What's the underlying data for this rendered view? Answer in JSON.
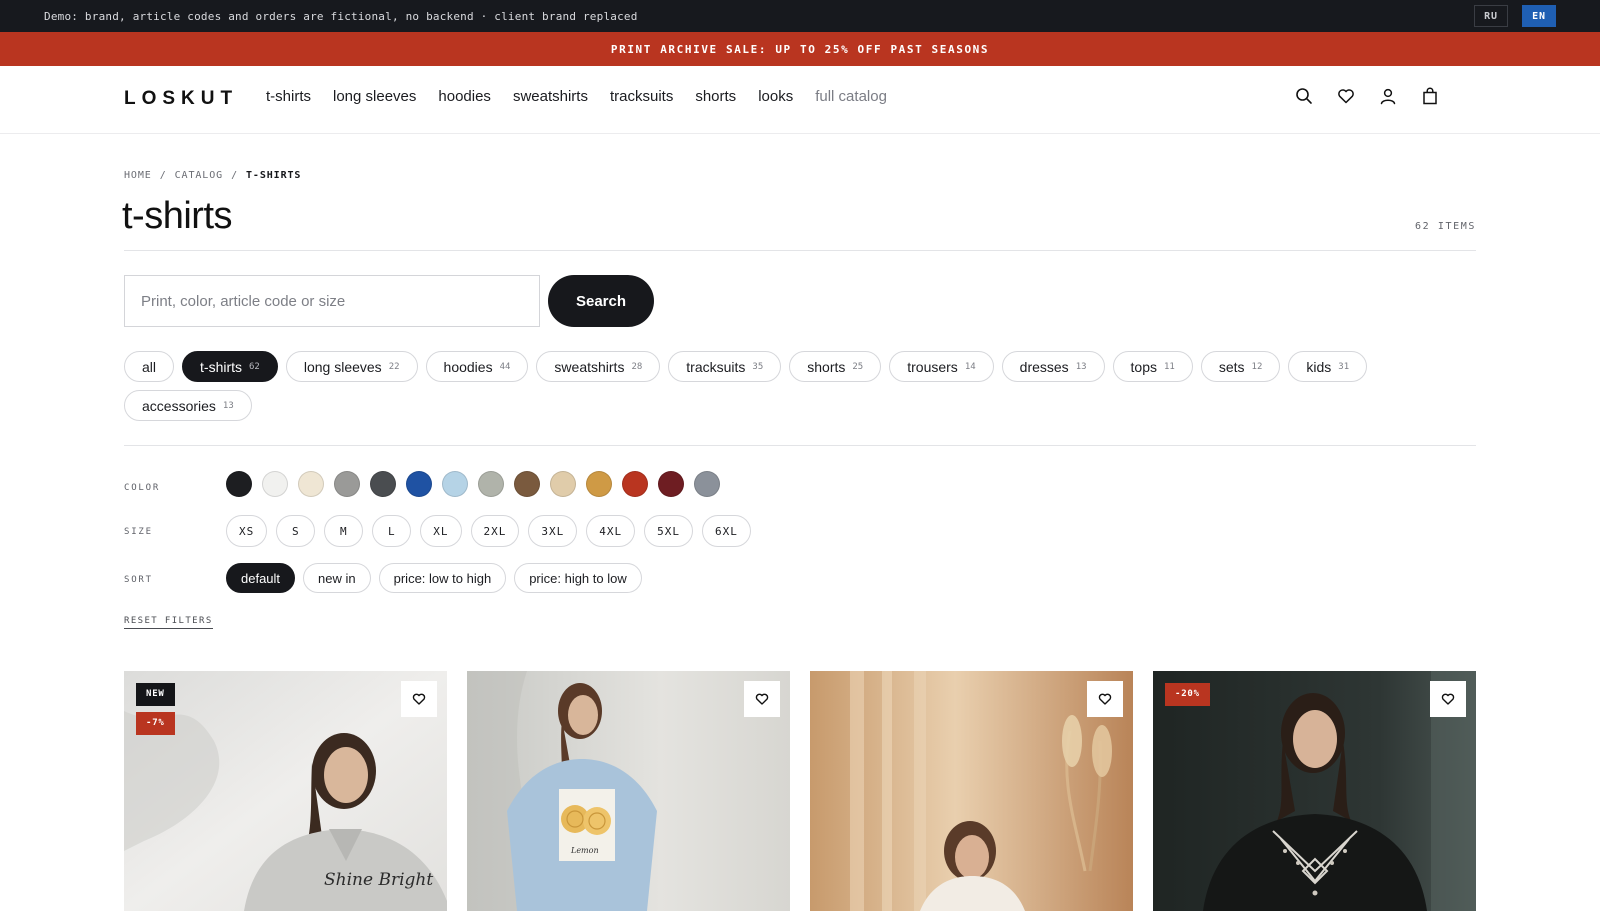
{
  "demo": {
    "text": "Demo: brand, article codes and orders are fictional, no backend · client brand replaced",
    "languages": [
      {
        "label": "RU",
        "active": false
      },
      {
        "label": "EN",
        "active": true
      }
    ]
  },
  "promo": {
    "text": "PRINT ARCHIVE SALE: UP TO 25% OFF PAST SEASONS"
  },
  "header": {
    "logo": "LOSKUT",
    "nav": [
      {
        "label": "t-shirts"
      },
      {
        "label": "long sleeves"
      },
      {
        "label": "hoodies"
      },
      {
        "label": "sweatshirts"
      },
      {
        "label": "tracksuits"
      },
      {
        "label": "shorts"
      },
      {
        "label": "looks"
      },
      {
        "label": "full catalog"
      }
    ],
    "icons": [
      "search-icon",
      "heart-icon",
      "user-icon",
      "bag-icon"
    ]
  },
  "breadcrumb": {
    "home": "HOME",
    "sep": "/",
    "catalog": "CATALOG",
    "current": "T-SHIRTS"
  },
  "page": {
    "title": "t-shirts",
    "count": "62 ITEMS"
  },
  "search": {
    "placeholder": "Print, color, article code or size",
    "button": "Search"
  },
  "categories": [
    {
      "label": "all",
      "count": ""
    },
    {
      "label": "t-shirts",
      "count": "62",
      "active": true
    },
    {
      "label": "long sleeves",
      "count": "22"
    },
    {
      "label": "hoodies",
      "count": "44"
    },
    {
      "label": "sweatshirts",
      "count": "28"
    },
    {
      "label": "tracksuits",
      "count": "35"
    },
    {
      "label": "shorts",
      "count": "25"
    },
    {
      "label": "trousers",
      "count": "14"
    },
    {
      "label": "dresses",
      "count": "13"
    },
    {
      "label": "tops",
      "count": "11"
    },
    {
      "label": "sets",
      "count": "12"
    },
    {
      "label": "kids",
      "count": "31"
    },
    {
      "label": "accessories",
      "count": "13"
    }
  ],
  "filters": {
    "color_label": "COLOR",
    "colors": [
      "#1d1e21",
      "#f1f1ef",
      "#efe6d4",
      "#9a9a98",
      "#4a4d50",
      "#1f52a3",
      "#b5d3e6",
      "#b0b3aa",
      "#7a5a3e",
      "#e0ccaa",
      "#cf9a45",
      "#b93520",
      "#6e1d22",
      "#8b919a"
    ],
    "size_label": "SIZE",
    "sizes": [
      "XS",
      "S",
      "M",
      "L",
      "XL",
      "2XL",
      "3XL",
      "4XL",
      "5XL",
      "6XL"
    ],
    "sort_label": "SORT",
    "sorts": [
      {
        "label": "default",
        "active": true
      },
      {
        "label": "new in"
      },
      {
        "label": "price: low to high"
      },
      {
        "label": "price: high to low"
      }
    ],
    "reset": "RESET FILTERS"
  },
  "products": [
    {
      "badges": [
        {
          "text": "NEW",
          "type": "new"
        },
        {
          "text": "-7%",
          "type": "sale"
        }
      ],
      "print_text": "Shine Bright"
    },
    {
      "badges": [],
      "print_text": "Lemon"
    },
    {
      "badges": []
    },
    {
      "badges": [
        {
          "text": "-20%",
          "type": "sale"
        }
      ]
    }
  ]
}
